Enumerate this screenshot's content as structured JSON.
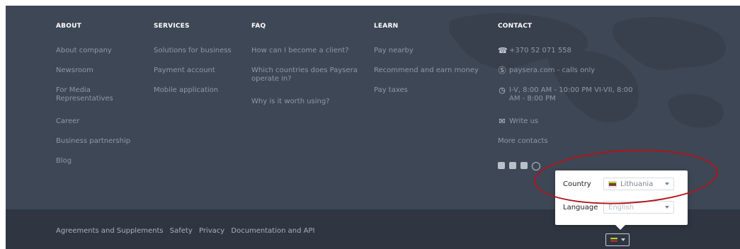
{
  "colors": {
    "footer_bg": "#3e4755",
    "bottom_bg": "#2f3641",
    "link": "#8e98a8",
    "heading": "#ffffff",
    "annotation_red": "#b2141a"
  },
  "columns": {
    "about": {
      "title": "ABOUT",
      "items": [
        "About company",
        "Newsroom",
        "For Media",
        "Representatives",
        "Career",
        "Business partnership",
        "Blog"
      ]
    },
    "services": {
      "title": "SERVICES",
      "items": [
        "Solutions for business",
        "Payment account",
        "Mobile application"
      ]
    },
    "faq": {
      "title": "FAQ",
      "items": [
        "How can I become a client?",
        "Which countries does Paysera",
        "operate in?",
        "Why is it worth using?"
      ]
    },
    "learn": {
      "title": "LEARN",
      "items": [
        "Pay nearby",
        "Recommend and earn money",
        "Pay taxes"
      ]
    },
    "contact": {
      "title": "CONTACT",
      "phone": "+370 52 071 558",
      "skype": "paysera.com - calls only",
      "hours_line1": "I-V, 8:00 AM - 10:00 PM VI-VII, 8:00",
      "hours_line2": "AM - 8:00 PM",
      "write_us": "Write us",
      "more_contacts": "More contacts",
      "social_icons": [
        "facebook-icon",
        "linkedin-icon",
        "youtube-icon",
        "instagram-icon"
      ]
    }
  },
  "bottom": {
    "links": [
      "Agreements and Supplements",
      "Safety",
      "Privacy",
      "Documentation and API"
    ]
  },
  "popover": {
    "country_label": "Country",
    "country_value": "Lithuania",
    "language_label": "Language",
    "language_value": "English"
  }
}
